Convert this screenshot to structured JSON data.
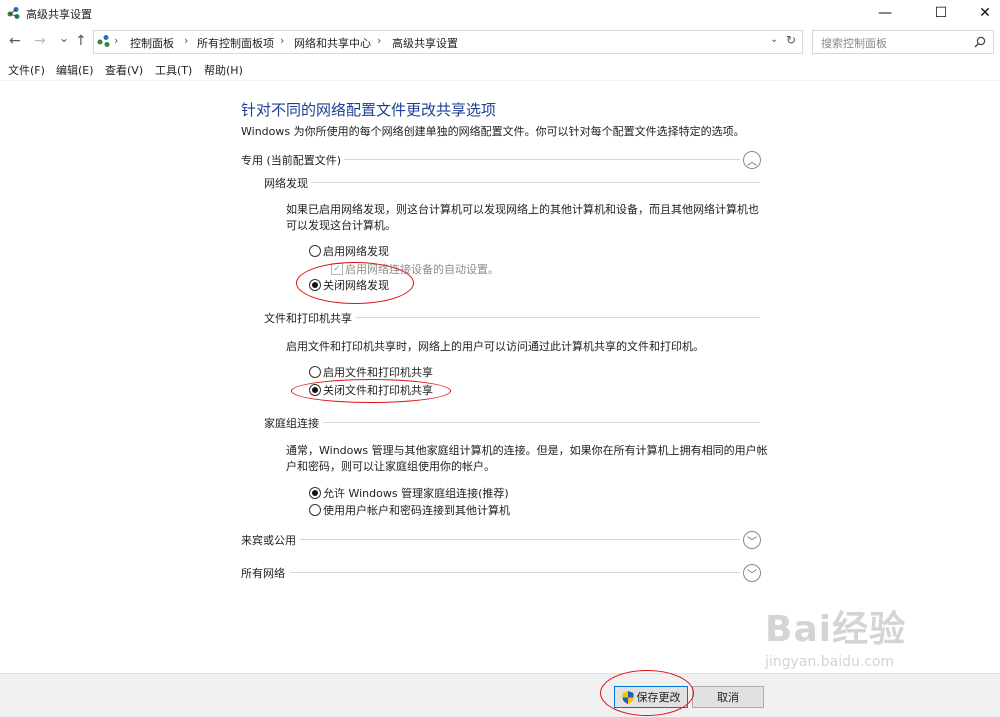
{
  "window": {
    "title": "高级共享设置"
  },
  "nav": {
    "back": "←",
    "forward": "→",
    "recent": "⌄",
    "up": "↑"
  },
  "breadcrumbs": [
    "控制面板",
    "所有控制面板项",
    "网络和共享中心",
    "高级共享设置"
  ],
  "search": {
    "placeholder": "搜索控制面板"
  },
  "menu": [
    "文件(F)",
    "编辑(E)",
    "查看(V)",
    "工具(T)",
    "帮助(H)"
  ],
  "main": {
    "heading": "针对不同的网络配置文件更改共享选项",
    "intro": "Windows 为你所使用的每个网络创建单独的网络配置文件。你可以针对每个配置文件选择特定的选项。",
    "private": {
      "label": "专用 (当前配置文件)",
      "discovery": {
        "title": "网络发现",
        "desc_line1": "如果已启用网络发现，则这台计算机可以发现网络上的其他计算机和设备，而且其他网络计算机也",
        "desc_line2": "可以发现这台计算机。",
        "on_label": "启用网络发现",
        "auto_label": "启用网络连接设备的自动设置。",
        "off_label": "关闭网络发现",
        "selected": "off"
      },
      "file_sharing": {
        "title": "文件和打印机共享",
        "desc": "启用文件和打印机共享时，网络上的用户可以访问通过此计算机共享的文件和打印机。",
        "on_label": "启用文件和打印机共享",
        "off_label": "关闭文件和打印机共享",
        "selected": "off"
      },
      "homegroup": {
        "title": "家庭组连接",
        "desc_line1": "通常，Windows 管理与其他家庭组计算机的连接。但是，如果你在所有计算机上拥有相同的用户帐",
        "desc_line2": "户和密码，则可以让家庭组使用你的帐户。",
        "allow_label": "允许 Windows 管理家庭组连接(推荐)",
        "use_account_label": "使用用户帐户和密码连接到其他计算机",
        "selected": "allow"
      }
    },
    "guest": {
      "label": "来宾或公用"
    },
    "all": {
      "label": "所有网络"
    }
  },
  "footer": {
    "save_label": "保存更改",
    "cancel_label": "取消"
  },
  "watermark": {
    "line1": "Bai经验",
    "line2": "jingyan.baidu.com"
  },
  "colors": {
    "heading": "#1c3f94",
    "annotation": "#dd1111",
    "accent": "#0078d7"
  }
}
